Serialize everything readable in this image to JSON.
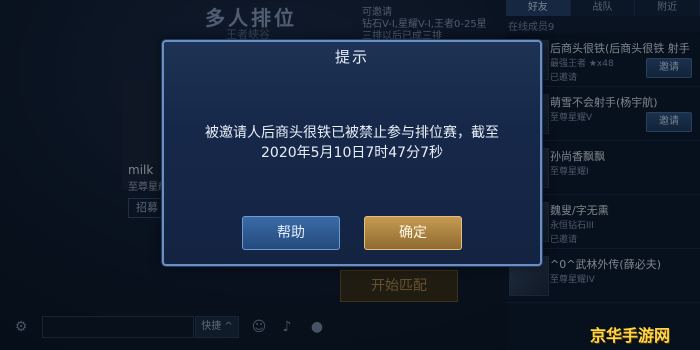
{
  "header": {
    "title": "多人排位",
    "subtitle": "王者峡谷",
    "room_info": [
      "可邀请",
      "钻石V-I,星耀V-I,王者0-25星",
      "三排以后已成三排"
    ]
  },
  "friends_panel": {
    "tabs": [
      {
        "label": "好友",
        "active": true
      },
      {
        "label": "战队",
        "active": false
      },
      {
        "label": "附近",
        "active": false
      }
    ],
    "online_text": "在线成员9",
    "friends": [
      {
        "name": "后商头很铁(后商头很铁 射手",
        "rank": "最强王者 ★x48",
        "badge": "已邀请",
        "invite_label": "邀请"
      },
      {
        "name": "萌雪不会射手(杨宇航)",
        "rank": "至尊星耀V",
        "badge": "",
        "invite_label": "邀请"
      },
      {
        "name": "孙尚香飘飘",
        "rank": "至尊星耀I",
        "badge": "",
        "invite_label": ""
      },
      {
        "name": "魏叟/字无熏",
        "rank": "永恒钻石III",
        "badge": "已邀请",
        "invite_label": ""
      },
      {
        "name": "^0^武林外传(薛必夫)",
        "rank": "至尊星耀IV",
        "badge": "",
        "invite_label": ""
      }
    ]
  },
  "player": {
    "name": "milk",
    "rank": "至尊星耀",
    "recruit_label": "招募"
  },
  "start_label": "开始匹配",
  "chat": {
    "quick_label": "快捷 ^"
  },
  "dialog": {
    "title": "提示",
    "message_line1": "被邀请人后商头很铁已被禁止参与排位赛，截至",
    "message_line2": "2020年5月10日7时47分7秒",
    "help_label": "帮助",
    "ok_label": "确定"
  },
  "watermark": "京华手游网"
}
